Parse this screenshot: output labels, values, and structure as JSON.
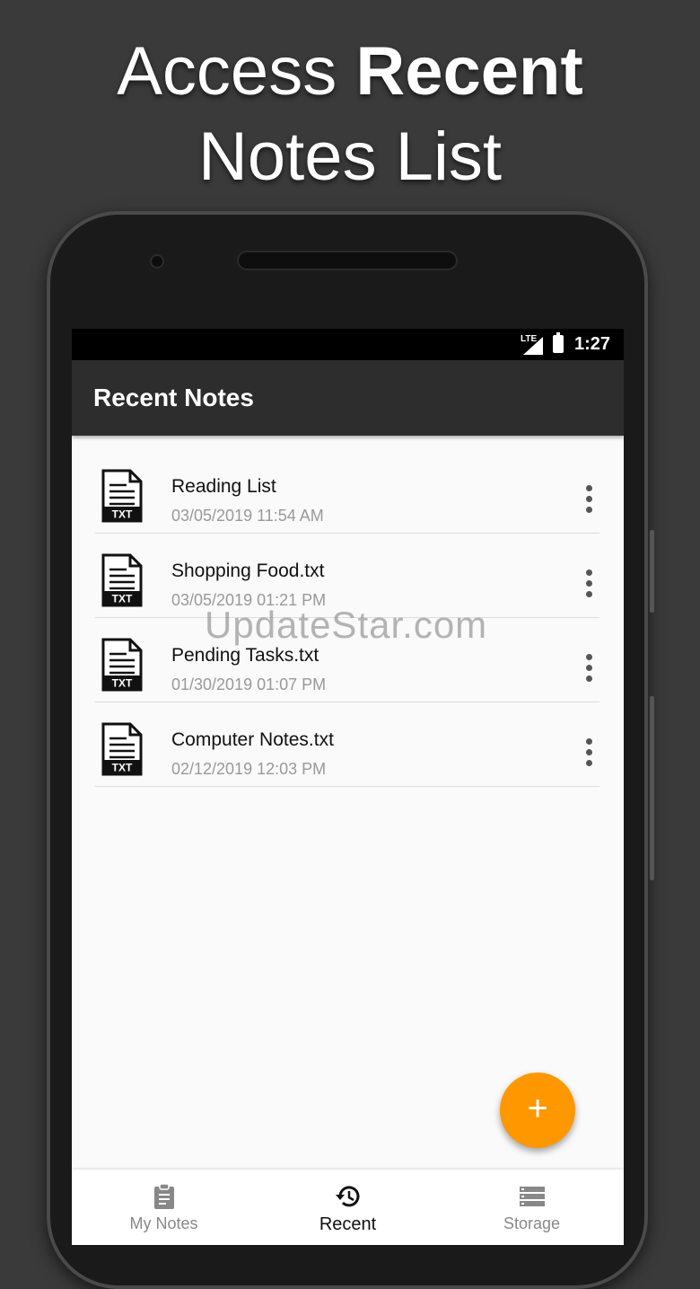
{
  "headline": {
    "line1_light": "Access",
    "line1_bold": "Recent",
    "line2": "Notes List"
  },
  "statusbar": {
    "network": "LTE",
    "time": "1:27"
  },
  "appbar": {
    "title": "Recent Notes"
  },
  "notes": [
    {
      "name": "Reading List",
      "date": "03/05/2019 11:54 AM",
      "badge": "TXT"
    },
    {
      "name": "Shopping Food.txt",
      "date": "03/05/2019 01:21 PM",
      "badge": "TXT"
    },
    {
      "name": "Pending Tasks.txt",
      "date": "01/30/2019 01:07 PM",
      "badge": "TXT"
    },
    {
      "name": "Computer Notes.txt",
      "date": "02/12/2019 12:03 PM",
      "badge": "TXT"
    }
  ],
  "watermark": "UpdateStar.com",
  "fab": {
    "icon": "plus-icon",
    "glyph": "+",
    "color": "#ff9800"
  },
  "bottom_nav": [
    {
      "label": "My Notes",
      "icon": "clipboard-icon",
      "active": false
    },
    {
      "label": "Recent",
      "icon": "history-icon",
      "active": true
    },
    {
      "label": "Storage",
      "icon": "storage-icon",
      "active": false
    }
  ]
}
